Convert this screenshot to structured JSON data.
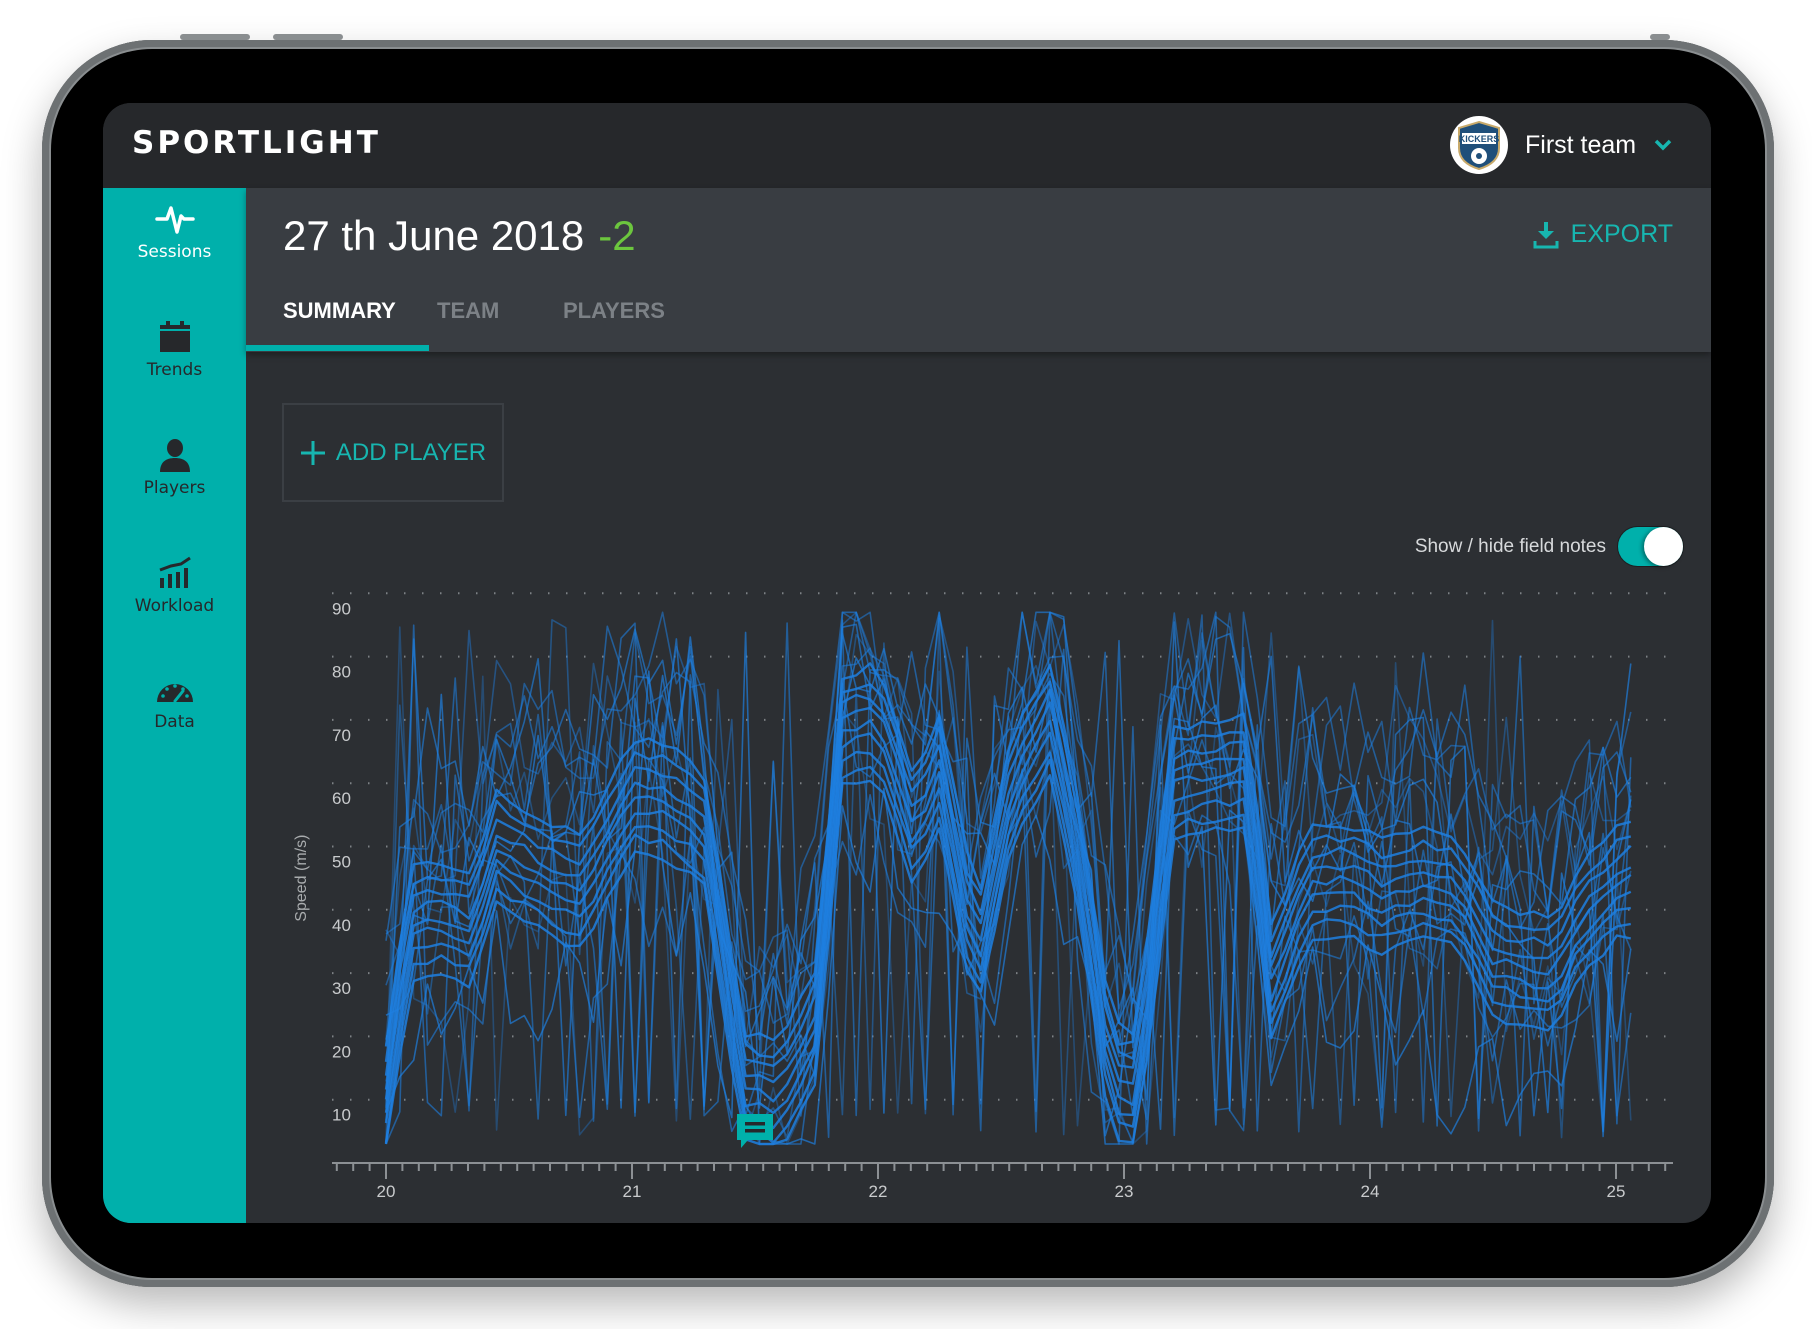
{
  "app": {
    "brand": "SPORTLIGHT",
    "team_selector": {
      "label": "First team",
      "badge_text": "KICKERS",
      "icon": "chevron-down-icon"
    }
  },
  "sidebar": {
    "items": [
      {
        "label": "Sessions",
        "icon": "heartbeat-icon",
        "active": true
      },
      {
        "label": "Trends",
        "icon": "calendar-icon",
        "active": false
      },
      {
        "label": "Players",
        "icon": "person-icon",
        "active": false
      },
      {
        "label": "Workload",
        "icon": "bar-trend-icon",
        "active": false
      },
      {
        "label": "Data",
        "icon": "gauge-icon",
        "active": false
      }
    ]
  },
  "session": {
    "title": "27 th June 2018",
    "delta": "-2",
    "export_label": "EXPORT",
    "tabs": [
      {
        "label": "SUMMARY",
        "active": true
      },
      {
        "label": "TEAM",
        "active": false
      },
      {
        "label": "PLAYERS",
        "active": false
      }
    ],
    "add_player_label": "ADD PLAYER",
    "field_notes_label": "Show / hide field notes",
    "field_notes_on": true
  },
  "colors": {
    "accent": "#00b0ab",
    "accent_text": "#17b6b0",
    "delta_green": "#6cc63e",
    "series_blue": "#1e7fe0",
    "background": "#2c2f33"
  },
  "chart_data": {
    "type": "line",
    "title": "",
    "xlabel": "",
    "ylabel": "Speed (m/s)",
    "x_ticks": [
      "20",
      "21",
      "22",
      "23",
      "24",
      "25"
    ],
    "y_ticks": [
      "10",
      "20",
      "30",
      "40",
      "50",
      "60",
      "70",
      "80",
      "90"
    ],
    "xlim": [
      20,
      25.22
    ],
    "ylim": [
      0,
      90
    ],
    "grid": "horizontal-dotted",
    "minor_ticks_per_major": 15,
    "field_note_markers": [
      {
        "x": 21.5,
        "y": 4
      }
    ],
    "series_count": 24,
    "x_start": 20,
    "x_end": 25.06,
    "band_profile": {
      "x": [
        20,
        20.1,
        20.2,
        20.35,
        20.45,
        20.7,
        20.8,
        21.0,
        21.15,
        21.3,
        21.45,
        21.6,
        21.75,
        21.85,
        22.0,
        22.15,
        22.25,
        22.4,
        22.55,
        22.7,
        22.8,
        22.95,
        23.05,
        23.2,
        23.35,
        23.5,
        23.6,
        23.75,
        23.9,
        24.05,
        24.2,
        24.35,
        24.5,
        24.6,
        24.75,
        24.85,
        25.0,
        25.06
      ],
      "y": [
        10,
        38,
        39,
        37,
        50,
        44,
        43,
        58,
        57,
        52,
        12,
        10,
        22,
        68,
        70,
        52,
        62,
        32,
        60,
        70,
        52,
        13,
        12,
        60,
        61,
        62,
        28,
        44,
        45,
        42,
        44,
        43,
        32,
        31,
        30,
        38,
        44,
        45
      ]
    }
  }
}
